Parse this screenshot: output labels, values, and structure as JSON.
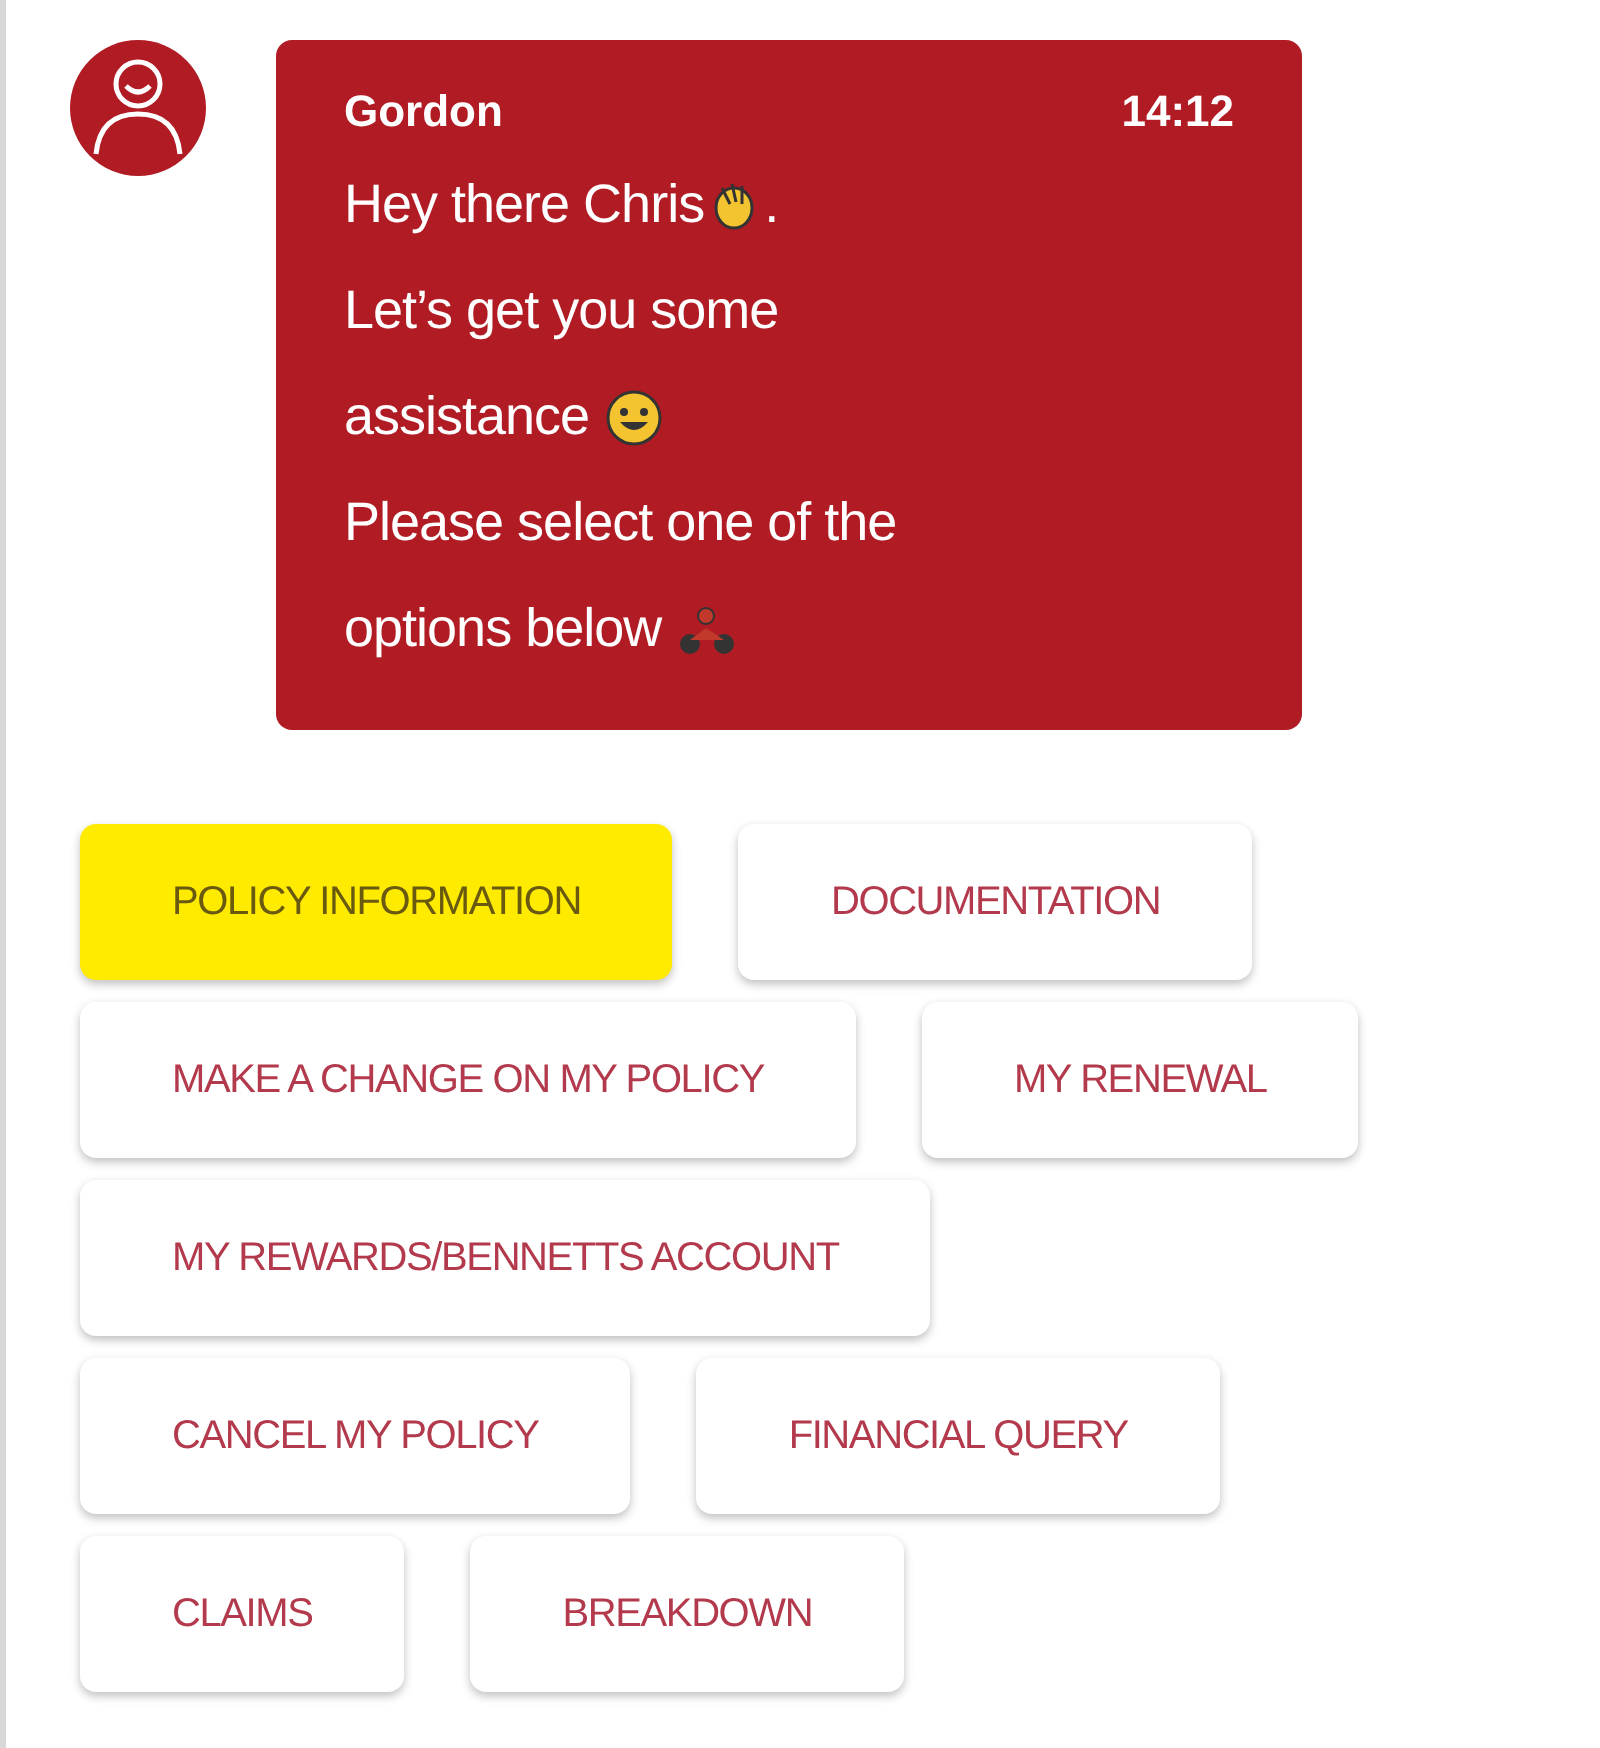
{
  "message": {
    "sender": "Gordon",
    "time": "14:12",
    "lines": [
      {
        "text": "Hey there Chris",
        "icon": {
          "kind": "wave"
        },
        "after": "."
      },
      {
        "text": "Let’s get you some"
      },
      {
        "text": "assistance ",
        "icon": {
          "kind": "smile"
        }
      },
      {
        "text": "Please select one of the"
      },
      {
        "text": "options below ",
        "icon": {
          "kind": "motorbike"
        }
      }
    ]
  },
  "option_rows": [
    {
      "buttons": [
        {
          "label": "POLICY INFORMATION",
          "highlighted": true
        },
        {
          "label": "DOCUMENTATION",
          "highlighted": false
        }
      ]
    },
    {
      "buttons": [
        {
          "label": "MAKE A CHANGE ON MY POLICY",
          "highlighted": false
        },
        {
          "label": "MY RENEWAL",
          "highlighted": false
        }
      ]
    },
    {
      "buttons": [
        {
          "label": "MY REWARDS/BENNETTS ACCOUNT",
          "highlighted": false
        }
      ]
    },
    {
      "buttons": [
        {
          "label": "CANCEL MY POLICY",
          "highlighted": false
        },
        {
          "label": "FINANCIAL QUERY",
          "highlighted": false
        }
      ]
    },
    {
      "buttons": [
        {
          "label": "CLAIMS",
          "highlighted": false
        },
        {
          "label": "BREAKDOWN",
          "highlighted": false
        }
      ]
    }
  ]
}
